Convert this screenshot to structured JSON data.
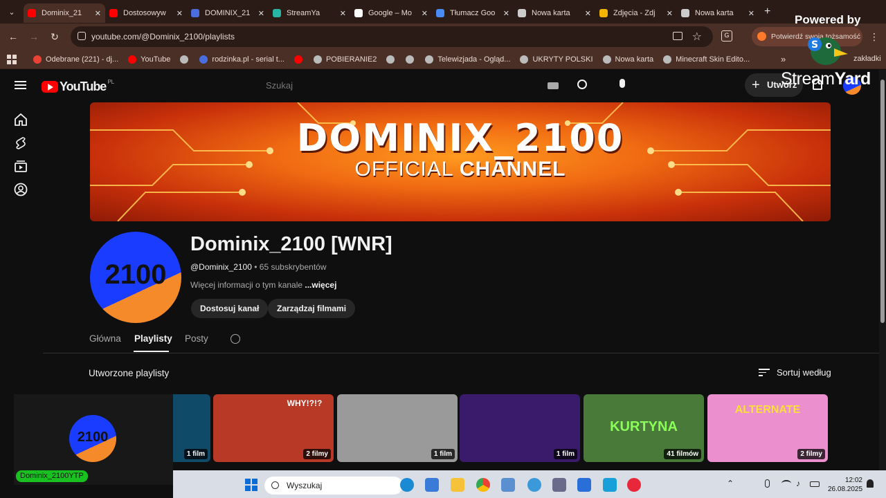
{
  "browser": {
    "tabs": [
      {
        "label": "Dominix_21",
        "color": "#ff0000",
        "active": true
      },
      {
        "label": "Dostosowyw",
        "color": "#ff0000"
      },
      {
        "label": "DOMINIX_21",
        "color": "#4a6ee0"
      },
      {
        "label": "StreamYa",
        "color": "#27b6a6"
      },
      {
        "label": "Google – Mo",
        "color": "#ffffff"
      },
      {
        "label": "Tłumacz Goo",
        "color": "#4a8af4"
      },
      {
        "label": "Nowa karta",
        "color": "#cccccc"
      },
      {
        "label": "Zdjęcia - Zdj",
        "color": "#f5b400"
      },
      {
        "label": "Nowa karta",
        "color": "#cccccc"
      }
    ],
    "url": "youtube.com/@Dominix_2100/playlists",
    "profile_badge": "Potwierdź swoją tożsamość",
    "bookmarks": [
      {
        "label": "Odebrane (221) - dj...",
        "color": "#ea4335"
      },
      {
        "label": "YouTube",
        "color": "#ff0000"
      },
      {
        "label": "",
        "color": "#bbbbbb"
      },
      {
        "label": "rodzinka.pl - serial t...",
        "color": "#4a6ee0"
      },
      {
        "label": "",
        "color": "#ff0000"
      },
      {
        "label": "POBIERANIE2",
        "color": "#bbbbbb"
      },
      {
        "label": "",
        "color": "#bbbbbb"
      },
      {
        "label": "",
        "color": "#bbbbbb"
      },
      {
        "label": "Telewizjada - Ogląd...",
        "color": "#bbbbbb"
      },
      {
        "label": "UKRYTY POLSKI",
        "color": "#bbbbbb"
      },
      {
        "label": "Nowa karta",
        "color": "#bbbbbb"
      },
      {
        "label": "Minecraft Skin Edito...",
        "color": "#bbbbbb"
      }
    ],
    "bookmarks_overflow": "zakładki"
  },
  "youtube": {
    "logo_text": "YouTube",
    "logo_region": "PL",
    "search_placeholder": "Szukaj",
    "create_label": "Utwórz",
    "banner": {
      "title": "DOMINIX_2100",
      "subtitle_plain": "OFFICIAL ",
      "subtitle_bold": "CHANNEL"
    },
    "channel": {
      "avatar_text": "2100",
      "name": "Dominix_2100 [WNR]",
      "handle": "@Dominix_2100",
      "subscribers": "• 65 subskrybentów",
      "more_info": "Więcej informacji o tym kanale ",
      "more_link": "...więcej",
      "customize_button": "Dostosuj kanał",
      "manage_button": "Zarządzaj filmami"
    },
    "tabs": [
      "Główna",
      "Playlisty",
      "Posty"
    ],
    "active_tab": "Playlisty",
    "section_title": "Utworzone playlisty",
    "sort_label": "Sortuj według",
    "playlists": [
      {
        "count": "1 film",
        "thumb_text": "",
        "bg": "#0f4a68"
      },
      {
        "count": "2 filmy",
        "thumb_text": "WHY!?!?",
        "bg": "#b83a26"
      },
      {
        "count": "1 film",
        "thumb_text": "",
        "bg": "#9a9a9a"
      },
      {
        "count": "1 film",
        "thumb_text": "",
        "bg": "#3a1a6a"
      },
      {
        "count": "41 filmów",
        "thumb_text": "KURTYNA",
        "bg": "#4a7a3a"
      },
      {
        "count": "2 filmy",
        "thumb_text": "ALTERNATE",
        "bg": "#ec8fcf"
      }
    ]
  },
  "overlay": {
    "powered_by": "Powered by",
    "streamyard_a": "Stream",
    "streamyard_b": "Yard",
    "cam_avatar_text": "2100",
    "cam_label": "Dominix_2100YTP"
  },
  "taskbar": {
    "search_label": "Wyszukaj",
    "time": "12:02",
    "date": "26.08.2025"
  }
}
